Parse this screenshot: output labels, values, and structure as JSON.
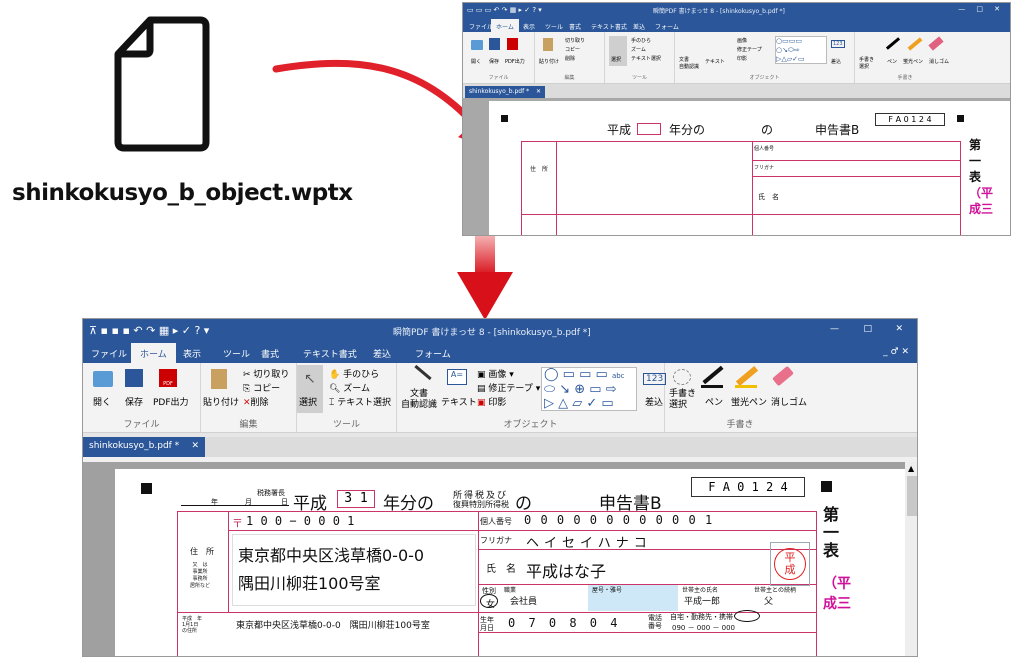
{
  "file_label": "shinkokusyo_b_object.wptx",
  "app": {
    "title": "瞬簡PDF 書けまっせ 8 - [shinkokusyo_b.pdf *]",
    "title_small": "瞬簡PDF 書けまっせ 8 - [shinkokusyo_b.pdf *]",
    "menu": [
      "ファイル",
      "ホーム",
      "表示",
      "ツール",
      "書式",
      "テキスト書式",
      "差込",
      "フォーム"
    ],
    "active_menu": "ホーム",
    "doc_tab": "shinkokusyo_b.pdf *",
    "win_min": "—",
    "win_max": "□",
    "win_close": "✕",
    "mdi_controls": "_ ♂ ✕",
    "groups": {
      "file": {
        "label": "ファイル",
        "open": "開く",
        "save": "保存",
        "pdf": "PDF出力"
      },
      "edit": {
        "label": "編集",
        "paste": "貼り付け",
        "cut": "切り取り",
        "copy": "コピー",
        "delete": "削除"
      },
      "tool": {
        "label": "ツール",
        "select": "選択",
        "hand": "手のひら",
        "zoom": "ズーム",
        "textselect": "テキスト選択"
      },
      "object": {
        "label": "オブジェクト",
        "docrec": "文書\n自動認識",
        "text": "テキスト",
        "image": "画像",
        "fix": "修正テープ",
        "stamp": "印影",
        "insert": "差込",
        "num": "123"
      },
      "hand": {
        "label": "手書き",
        "select": "手書き\n選択",
        "pen": "ペン",
        "marker": "蛍光ペン",
        "eraser": "消しゴム"
      }
    }
  },
  "form": {
    "tax_office": "税務署長",
    "year_lbl": "年",
    "month_lbl": "月",
    "day_lbl": "日",
    "era": "平成",
    "year_value": "3 1",
    "year_suffix": "年分の",
    "tax_kind_1": "所得税及び",
    "tax_kind_2": "復興特別所得税",
    "no": "の",
    "title": "申告書B",
    "code": "F A 0 1 2 4",
    "postal_mark": "〒",
    "postal": "1 0 0 − 0 0 0 1",
    "addr_label": "住　所",
    "addr_alt": "又　は\n事業所\n事務所\n居所など",
    "address_1": "東京都中央区浅草橋0-0-0",
    "address_2": "隅田川柳荘100号室",
    "mynumber_label": "個人番号",
    "mynumber": "0 0 0 0 0 0 0 0 0 0 0 1",
    "furigana_label": "フリガナ",
    "furigana": "ヘイセイハナコ",
    "name_label": "氏　名",
    "name": "平成はな子",
    "seal": "平\n成",
    "sex_label": "性別",
    "sex": "女",
    "job_label": "職業",
    "job": "会社員",
    "trade_label": "屋号・雅号",
    "head_label": "世帯主の氏名",
    "head": "平成一郎",
    "rel_label": "世帯主との続柄",
    "rel": "父",
    "jan1_label": "平成 年\n1月1日\nの住所",
    "jan1": "東京都中央区浅草橋0-0-0　隅田川柳荘100号室",
    "birth_label": "生年\n月日",
    "birth": "0 7   0 8   0 4",
    "phone_label": "電話\n番号",
    "phone_kind": "自宅・勤務先・携帯",
    "phone": "090 － 000 － 000",
    "side_1": "第",
    "side_2": "一",
    "side_3": "表",
    "side_4": "（平",
    "side_5": "成三"
  }
}
